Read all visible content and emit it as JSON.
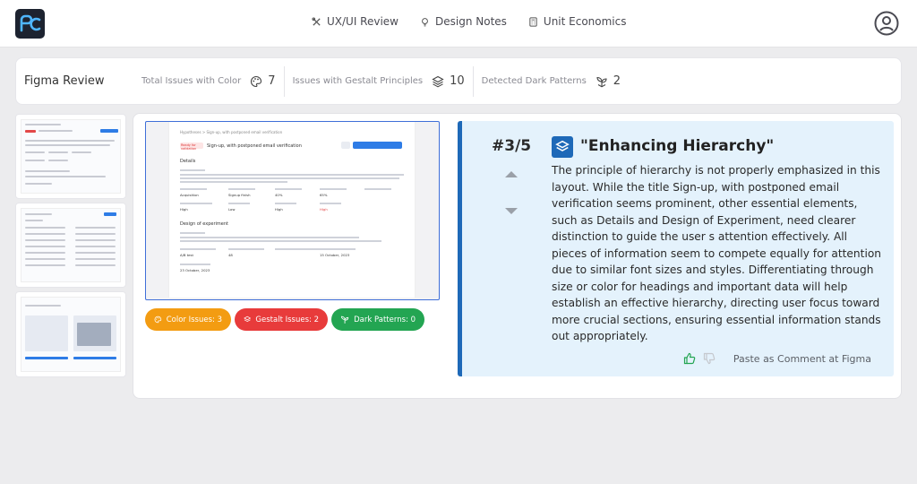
{
  "app": {
    "logo_text": "pc"
  },
  "nav": {
    "items": [
      {
        "label": "UX/UI Review",
        "icon": "tools-icon"
      },
      {
        "label": "Design Notes",
        "icon": "lightbulb-icon"
      },
      {
        "label": "Unit Economics",
        "icon": "calculator-icon"
      }
    ]
  },
  "stats": {
    "title": "Figma Review",
    "color": {
      "label": "Total Issues with Color",
      "value": "7"
    },
    "gestalt": {
      "label": "Issues with Gestalt Principles",
      "value": "10"
    },
    "dark": {
      "label": "Detected Dark Patterns",
      "value": "2"
    }
  },
  "preview": {
    "crumb": "Hypotheses > Sign-up, with postponed email verification",
    "badge": "Ready for validation",
    "title": "Sign-up, with postponed email verification",
    "section_details": "Details",
    "section_design": "Design of experiment",
    "rows1": [
      "Acquisition",
      "Signup finish",
      "40%",
      "65%"
    ],
    "rows2": [
      "High",
      "Low",
      "High",
      "High"
    ],
    "bottom": [
      "A/B test",
      "48",
      "15 October, 2023"
    ],
    "date": "23 October, 2023"
  },
  "chips": {
    "color": "Color Issues: 3",
    "gestalt": "Gestalt Issues: 2",
    "dark": "Dark Patterns: 0"
  },
  "issue": {
    "counter": "#3/5",
    "title": "\"Enhancing Hierarchy\"",
    "description": "The principle of hierarchy is not properly emphasized in this layout. While the title Sign-up, with postponed email verification seems prominent, other essential elements, such as Details and Design of Experiment, need clearer distinction to guide the user s attention effectively. All pieces of information seem to compete equally for attention due to similar font sizes and styles. Differentiating through size or color for headings and important data will help establish an effective hierarchy, directing user focus toward more crucial sections, ensuring essential information stands out appropriately.",
    "paste_label": "Paste as Comment at Figma"
  },
  "colors": {
    "accent": "#1e69b8",
    "orange": "#f39c12",
    "red": "#e83b3b",
    "green": "#23a552",
    "panel_bg": "#e4f2fc"
  }
}
